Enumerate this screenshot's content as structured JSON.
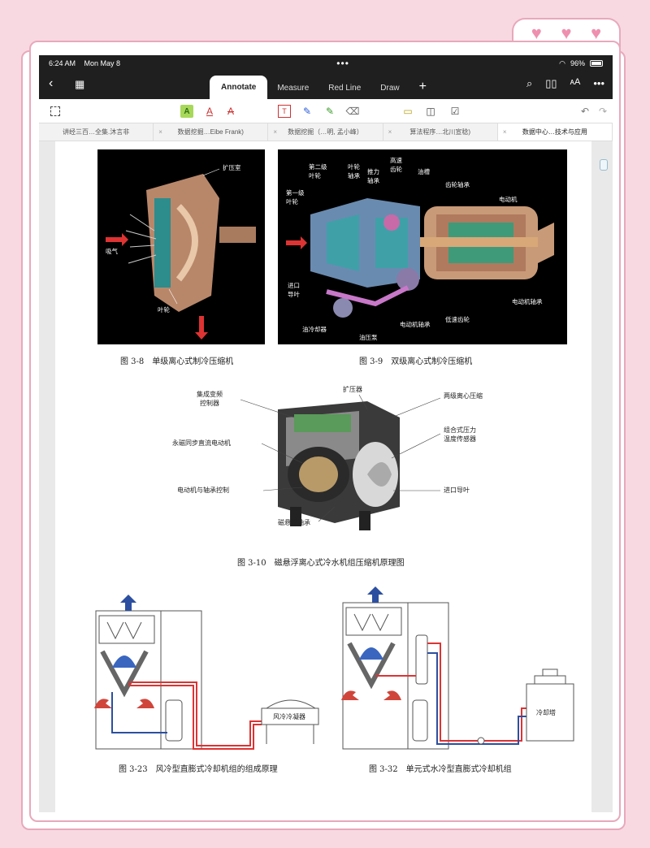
{
  "status": {
    "time": "6:24 AM",
    "date": "Mon May 8",
    "battery": "96%"
  },
  "toolbar": {
    "tabs": [
      "Annotate",
      "Measure",
      "Red Line",
      "Draw"
    ]
  },
  "doc_tabs": [
    "讲经三百…全集.沐言非",
    "数据挖掘…Eibe Frank)",
    "数据挖掘（…明, 孟小峰）",
    "算法程序…北川宣稔)",
    "数据中心…技术与应用"
  ],
  "figures": {
    "fig38": {
      "caption": "图 3-8　单级离心式制冷压缩机",
      "labels": {
        "diffuser": "扩压室",
        "intake": "吸气",
        "impeller": "叶轮"
      }
    },
    "fig39": {
      "caption": "图 3-9　双级离心式制冷压缩机",
      "labels": {
        "imp2": "第二级\n叶轮",
        "bearing_imp": "叶轮\n轴承",
        "thrust": "推力\n轴承",
        "hs_gear": "高速\n齿轮",
        "oil_tank": "油槽",
        "gear_bearing": "齿轮轴承",
        "motor": "电动机",
        "imp1": "第一级\n叶轮",
        "igv": "进口\n导叶",
        "oil_cooler": "油冷却器",
        "oil_pump": "油压泵",
        "motor_bearing": "电动机轴承",
        "ls_gear": "低速齿轮",
        "motor_bearing2": "电动机轴承"
      }
    },
    "fig310": {
      "caption": "图 3-10　磁悬浮离心式冷水机组压缩机原理图",
      "labels": {
        "vfd": "集成变频\n控制器",
        "diffuser": "扩压器",
        "two_stage": "两级离心压缩",
        "pm_motor": "永磁同步直流电动机",
        "sensor": "组合式压力\n温度传感器",
        "bearing_ctrl": "电动机与轴承控制",
        "igv": "进口导叶",
        "mag_bearing": "磁悬浮轴承"
      }
    },
    "fig323": {
      "caption": "图 3-23　风冷型直膨式冷却机组的组成原理",
      "labels": {
        "condenser": "风冷冷凝器"
      }
    },
    "fig332": {
      "caption": "图 3-32　单元式水冷型直膨式冷却机组",
      "labels": {
        "tower": "冷却塔"
      }
    }
  }
}
